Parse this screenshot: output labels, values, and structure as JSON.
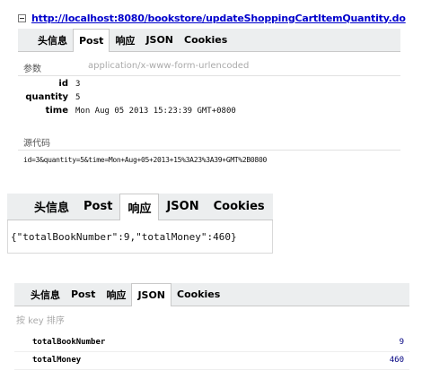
{
  "request": {
    "url": "http://localhost:8080/bookstore/updateShoppingCartItemQuantity.do",
    "tabs": [
      "头信息",
      "Post",
      "响应",
      "JSON",
      "Cookies"
    ],
    "params_label": "参数",
    "content_type": "application/x-www-form-urlencoded",
    "params": [
      {
        "name": "id",
        "value": "3"
      },
      {
        "name": "quantity",
        "value": "5"
      },
      {
        "name": "time",
        "value": "Mon Aug 05 2013 15:23:39 GMT+0800"
      }
    ],
    "source_label": "源代码",
    "source": "id=3&quantity=5&time=Mon+Aug+05+2013+15%3A23%3A39+GMT%2B0800"
  },
  "response": {
    "tabs": [
      "头信息",
      "Post",
      "响应",
      "JSON",
      "Cookies"
    ],
    "body": "{\"totalBookNumber\":9,\"totalMoney\":460}"
  },
  "json_view": {
    "tabs": [
      "头信息",
      "Post",
      "响应",
      "JSON",
      "Cookies"
    ],
    "sort_label": "按 key 排序",
    "rows": [
      {
        "key": "totalBookNumber",
        "value": "9"
      },
      {
        "key": "totalMoney",
        "value": "460"
      }
    ]
  }
}
